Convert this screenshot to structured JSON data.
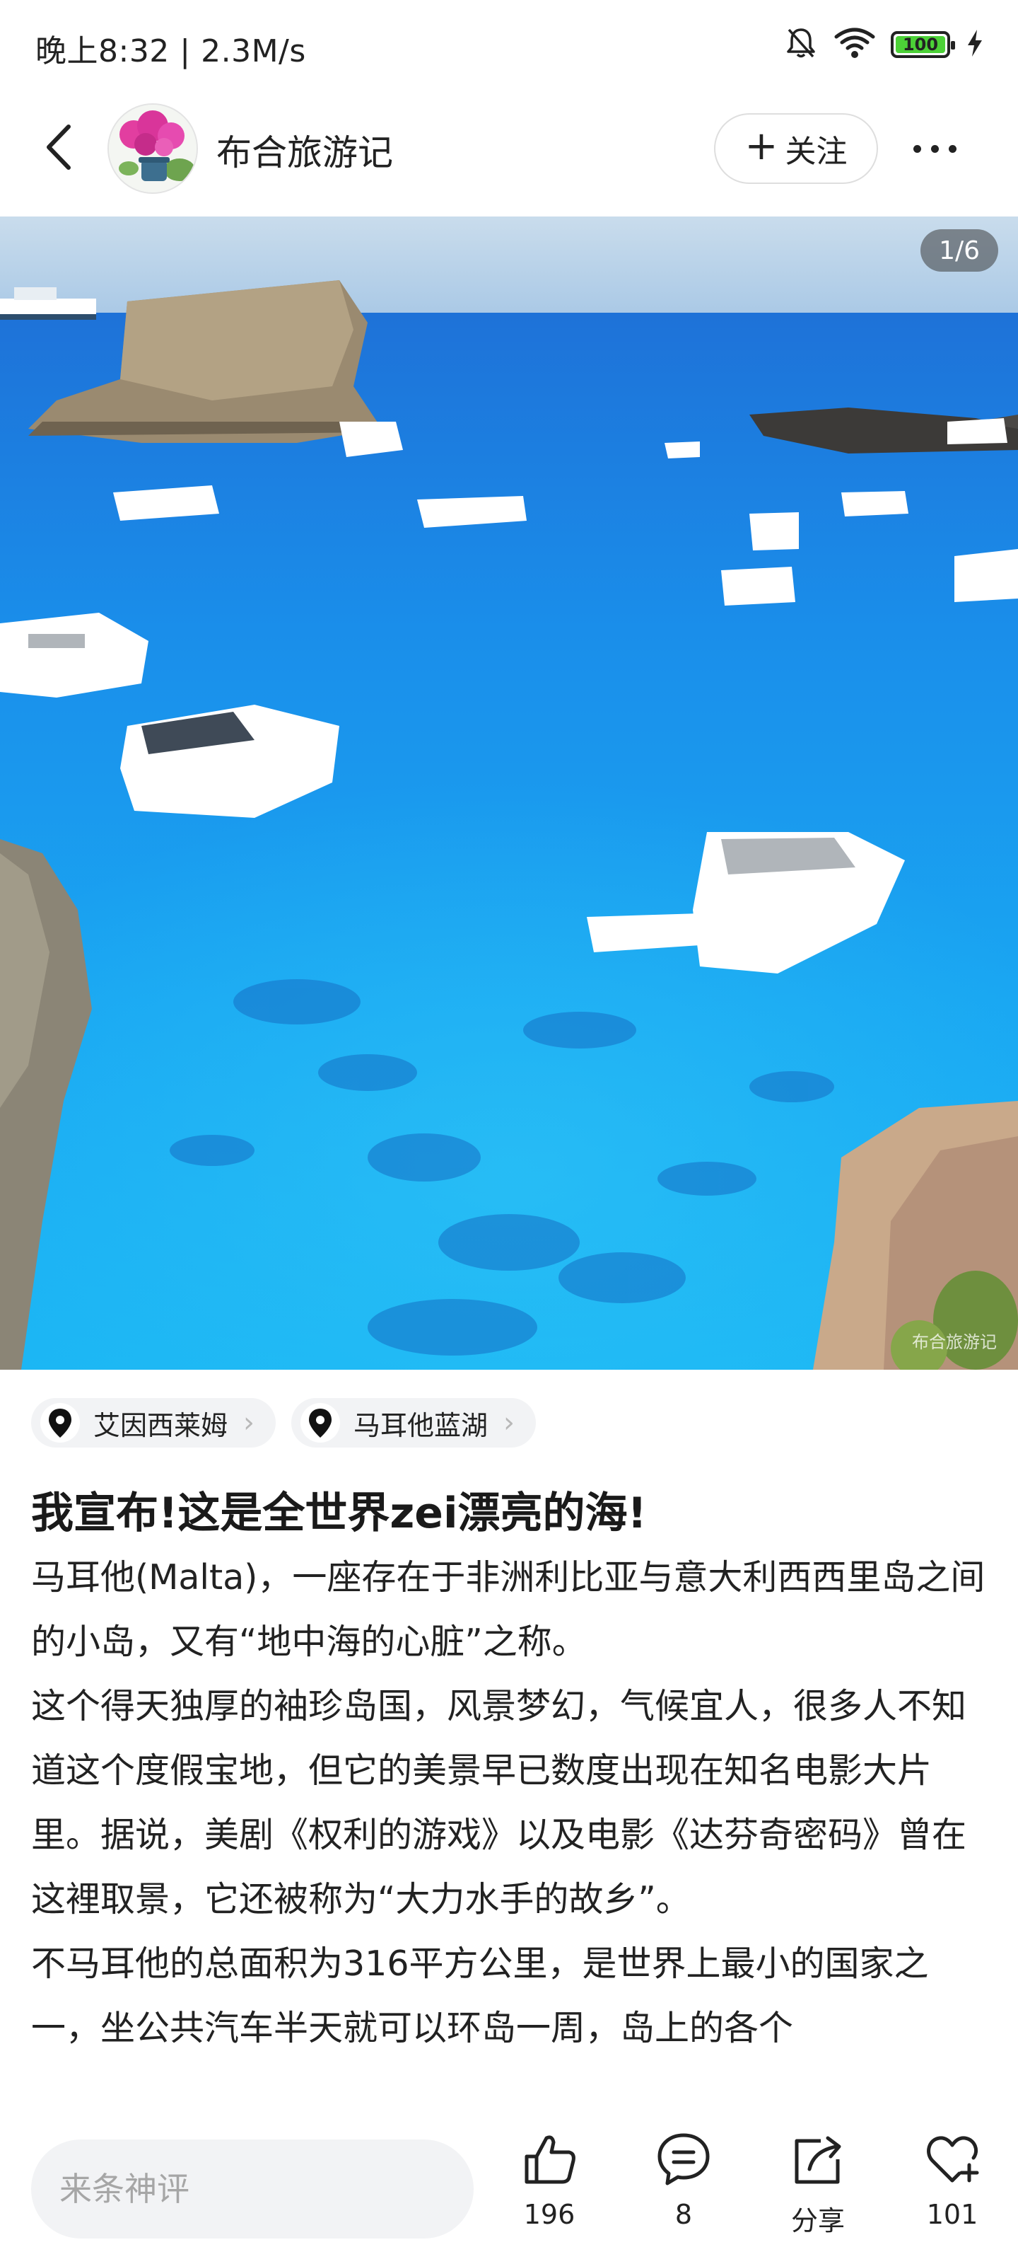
{
  "status_bar": {
    "time_speed": "晚上8:32 | 2.3M/s",
    "battery_level": "100",
    "battery_color": "#4cd137",
    "icons": [
      "bell-muted-icon",
      "wifi-icon",
      "battery-icon",
      "charging-bolt-icon"
    ]
  },
  "header": {
    "author_name": "布合旅游记",
    "follow_label": "关注",
    "back_icon": "chevron-left-icon",
    "more_icon": "ellipsis-icon"
  },
  "image": {
    "page_indicator": "1/6",
    "watermark": "布合旅游记"
  },
  "tags": [
    {
      "label": "艾因西莱姆",
      "icon": "location-pin-icon"
    },
    {
      "label": "马耳他蓝湖",
      "icon": "location-pin-icon"
    }
  ],
  "post": {
    "title": "我宣布!这是全世界zei漂亮的海!",
    "paragraphs": [
      "马耳他(Malta)，一座存在于非洲利比亚与意大利西西里岛之间的小岛，又有“地中海的心脏”之称。",
      "这个得天独厚的袖珍岛国，风景梦幻，气候宜人，很多人不知道这个度假宝地，但它的美景早已数度出现在知名电影大片里。据说，美剧《权利的游戏》以及电影《达芬奇密码》曾在这裡取景，它还被称为“大力水手的故乡”。",
      "不马耳他的总面积为316平方公里，是世界上最小的国家之一，坐公共汽车半天就可以环岛一周，岛上的各个"
    ]
  },
  "bottom_bar": {
    "comment_placeholder": "来条神评",
    "like_count": "196",
    "comment_count": "8",
    "share_label": "分享",
    "favorite_count": "101"
  }
}
